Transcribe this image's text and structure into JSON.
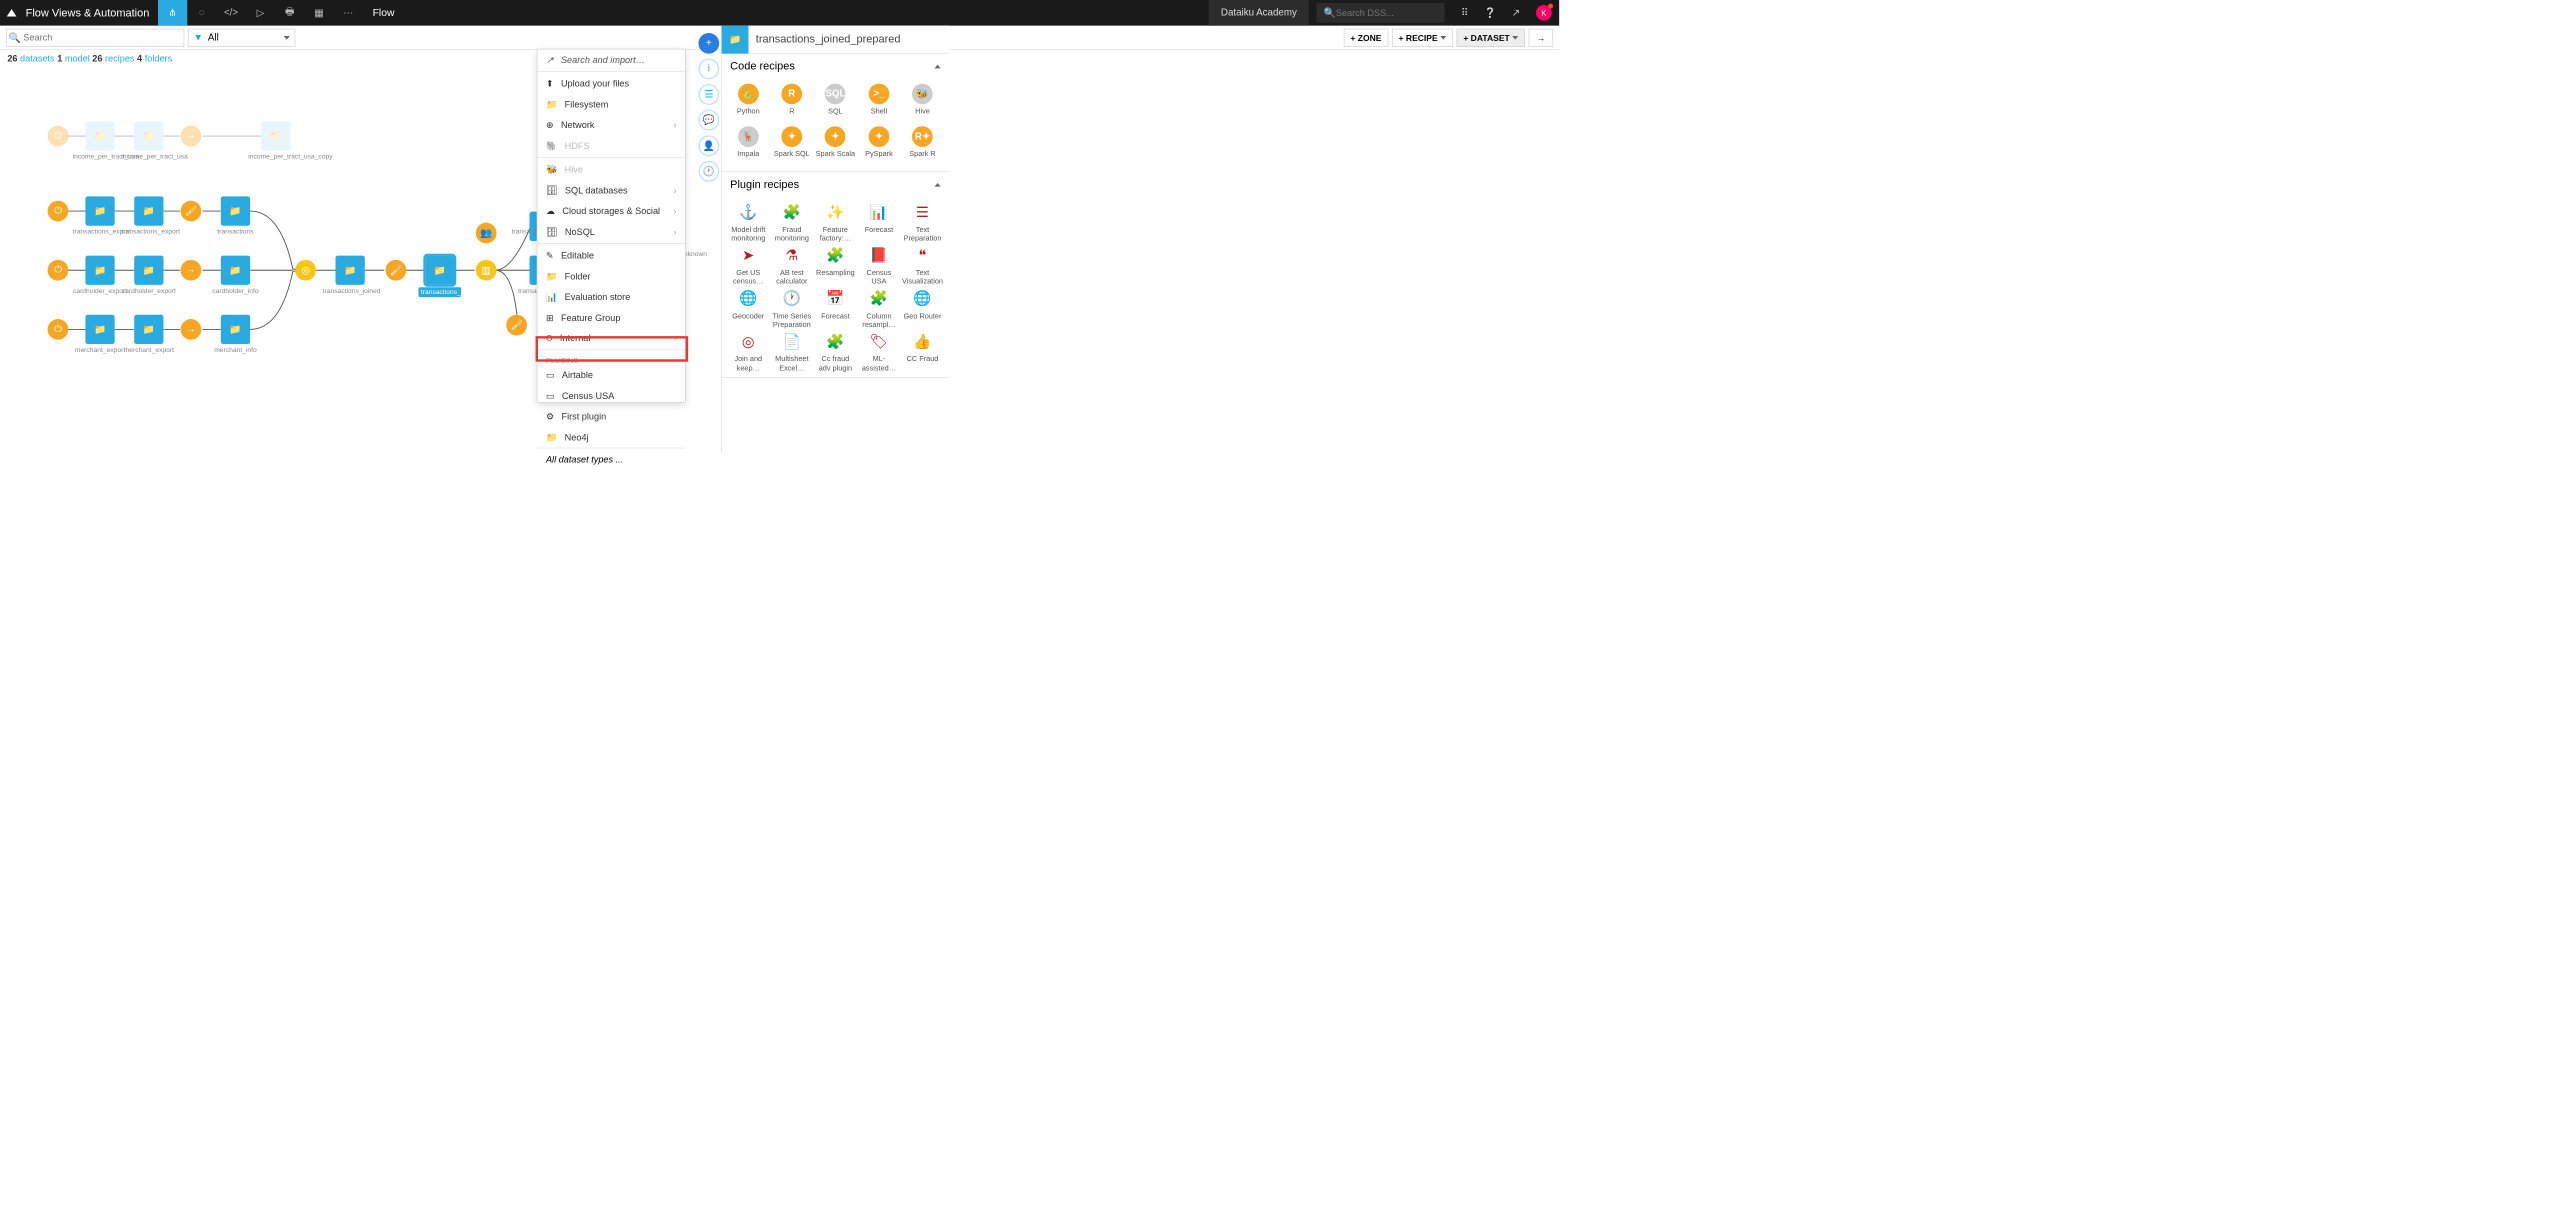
{
  "topbar": {
    "title": "Flow Views & Automation",
    "tab": "Flow",
    "academy": "Dataiku Academy",
    "search_placeholder": "Search DSS...",
    "avatar": "K"
  },
  "toolbar": {
    "search_placeholder": "Search",
    "filter": "All",
    "zone": "+ ZONE",
    "recipe": "+ RECIPE",
    "dataset": "+ DATASET"
  },
  "stats": {
    "n_datasets": "26",
    "datasets": "datasets",
    "n_model": "1",
    "model": "model",
    "n_recipes": "26",
    "recipes": "recipes",
    "n_folders": "4",
    "folders": "folders"
  },
  "nodes": {
    "r1n1": "income_per_tract_usa",
    "r1n2": "income_per_tract_usa",
    "r1n3": "income_per_tract_usa_copy",
    "r2n1": "transactions_export",
    "r2n2": "transactions_export",
    "r2n3": "transactions",
    "r3n1": "cardholder_export",
    "r3n2": "cardholder_export",
    "r3n3": "cardholder_info",
    "r4n1": "merchant_export",
    "r4n2": "merchant_export",
    "r4n3": "merchant_info",
    "joined": "transactions_joined",
    "prepared": "transactions_joined_prepared",
    "tm": "transactions_me",
    "tj": "transactions",
    "u": "unknown"
  },
  "dropdown": {
    "search": "Search and import…",
    "upload": "Upload your files",
    "fs": "Filesystem",
    "net": "Network",
    "hdfs": "HDFS",
    "hive": "Hive",
    "sql": "SQL databases",
    "cloud": "Cloud storages & Social",
    "nosql": "NoSQL",
    "edit": "Editable",
    "folder": "Folder",
    "eval": "Evaluation store",
    "feat": "Feature Group",
    "internal": "Internal",
    "plugins_hdr": "PLUGINS",
    "airtable": "Airtable",
    "census": "Census USA",
    "first": "First plugin",
    "neo4j": "Neo4j",
    "footer": "All dataset types ..."
  },
  "right": {
    "title": "transactions_joined_prepared",
    "code_recipes": "Code recipes",
    "plugin_recipes": "Plugin recipes",
    "code": [
      {
        "l": "Python",
        "c": "ic-orange",
        "t": "🐍"
      },
      {
        "l": "R",
        "c": "ic-orange",
        "t": "R"
      },
      {
        "l": "SQL",
        "c": "ic-grey",
        "t": "SQL"
      },
      {
        "l": "Shell",
        "c": "ic-orange",
        "t": ">_"
      },
      {
        "l": "Hive",
        "c": "ic-grey",
        "t": "🐝"
      },
      {
        "l": "Impala",
        "c": "ic-grey",
        "t": "🦌"
      },
      {
        "l": "Spark SQL",
        "c": "ic-orange",
        "t": "✦"
      },
      {
        "l": "Spark Scala",
        "c": "ic-orange",
        "t": "✦"
      },
      {
        "l": "PySpark",
        "c": "ic-orange",
        "t": "✦"
      },
      {
        "l": "Spark R",
        "c": "ic-orange",
        "t": "R✦"
      }
    ],
    "plugins": [
      {
        "l": "Model drift monitoring",
        "t": "⚓"
      },
      {
        "l": "Fraud monitoring",
        "t": "🧩"
      },
      {
        "l": "Feature factory:…",
        "t": "✨"
      },
      {
        "l": "Forecast",
        "t": "📊"
      },
      {
        "l": "Text Preparation",
        "t": "☰"
      },
      {
        "l": "Get US census…",
        "t": "➤"
      },
      {
        "l": "AB test calculator",
        "t": "⚗"
      },
      {
        "l": "Resampling",
        "t": "🧩"
      },
      {
        "l": "Census USA",
        "t": "📕"
      },
      {
        "l": "Text Visualization",
        "t": "❝"
      },
      {
        "l": "Geocoder",
        "t": "🌐"
      },
      {
        "l": "Time Series Preparation",
        "t": "🕐"
      },
      {
        "l": "Forecast",
        "t": "📅"
      },
      {
        "l": "Column resampl…",
        "t": "🧩"
      },
      {
        "l": "Geo Router",
        "t": "🌐"
      },
      {
        "l": "Join and keep…",
        "t": "◎"
      },
      {
        "l": "Multisheet Excel…",
        "t": "📄"
      },
      {
        "l": "Cc fraud adv plugin",
        "t": "🧩"
      },
      {
        "l": "ML-assisted…",
        "t": "🏷"
      },
      {
        "l": "CC Fraud",
        "t": "👍"
      }
    ]
  }
}
